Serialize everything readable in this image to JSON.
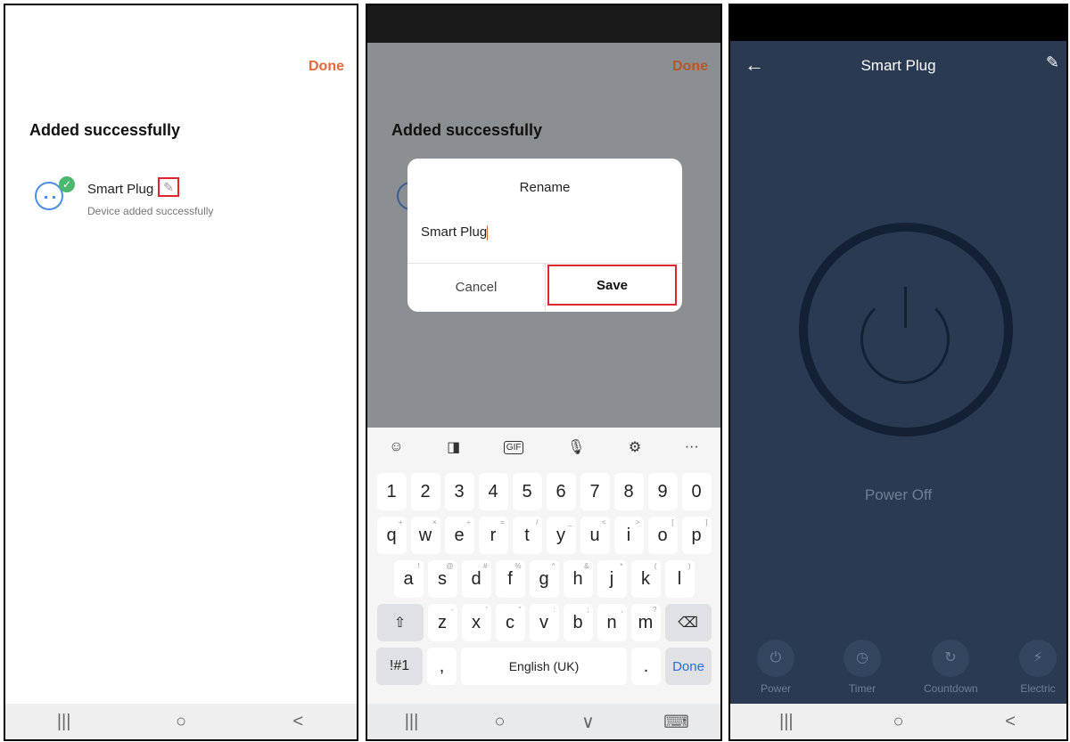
{
  "panel1": {
    "done": "Done",
    "heading": "Added successfully",
    "device_name": "Smart Plug",
    "device_subtitle": "Device added successfully",
    "edit_icon": "pencil-icon",
    "check_icon": "check-icon"
  },
  "panel2": {
    "done": "Done",
    "heading": "Added successfully",
    "dialog": {
      "title": "Rename",
      "input_value": "Smart Plug",
      "cancel": "Cancel",
      "save": "Save"
    },
    "keyboard": {
      "toolbar": [
        "☺",
        "◨",
        "GIF",
        "🎙",
        "⚙",
        "···"
      ],
      "row1": [
        "1",
        "2",
        "3",
        "4",
        "5",
        "6",
        "7",
        "8",
        "9",
        "0"
      ],
      "row2": [
        {
          "k": "q",
          "s": "+"
        },
        {
          "k": "w",
          "s": "×"
        },
        {
          "k": "e",
          "s": "÷"
        },
        {
          "k": "r",
          "s": "="
        },
        {
          "k": "t",
          "s": "/"
        },
        {
          "k": "y",
          "s": "_"
        },
        {
          "k": "u",
          "s": "<"
        },
        {
          "k": "i",
          "s": ">"
        },
        {
          "k": "o",
          "s": "["
        },
        {
          "k": "p",
          "s": "]"
        }
      ],
      "row3": [
        {
          "k": "a",
          "s": "!"
        },
        {
          "k": "s",
          "s": "@"
        },
        {
          "k": "d",
          "s": "#"
        },
        {
          "k": "f",
          "s": "%"
        },
        {
          "k": "g",
          "s": "^"
        },
        {
          "k": "h",
          "s": "&"
        },
        {
          "k": "j",
          "s": "*"
        },
        {
          "k": "k",
          "s": "("
        },
        {
          "k": "l",
          "s": ")"
        }
      ],
      "row4": [
        {
          "k": "z",
          "s": "-"
        },
        {
          "k": "x",
          "s": "'"
        },
        {
          "k": "c",
          "s": "\""
        },
        {
          "k": "v",
          "s": ":"
        },
        {
          "k": "b",
          "s": ";"
        },
        {
          "k": "n",
          "s": ","
        },
        {
          "k": "m",
          "s": "?"
        }
      ],
      "shift": "⇧",
      "backspace": "⌫",
      "symbols": "!#1",
      "comma": ",",
      "space": "English (UK)",
      "period": ".",
      "done": "Done"
    }
  },
  "panel3": {
    "back": "←",
    "title": "Smart Plug",
    "edit": "✎",
    "status": "Power Off",
    "controls": [
      {
        "label": "Power",
        "icon": "⏻"
      },
      {
        "label": "Timer",
        "icon": "◷"
      },
      {
        "label": "Countdown",
        "icon": "↻"
      },
      {
        "label": "Electric",
        "icon": "⚡"
      }
    ]
  },
  "navbar": {
    "recents": "|||",
    "home": "○",
    "back": "<",
    "hide_kb": "∨",
    "kb_switch": "⌨"
  }
}
